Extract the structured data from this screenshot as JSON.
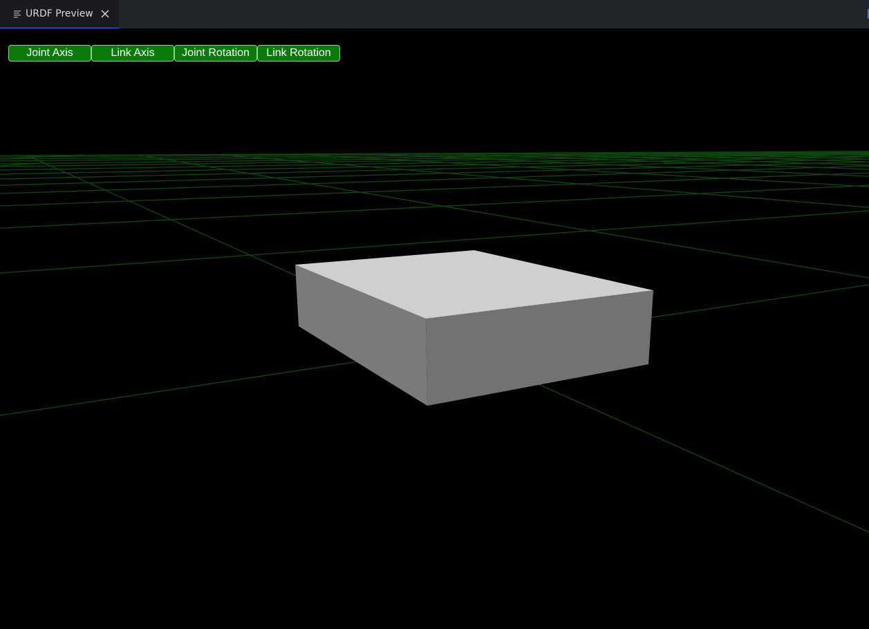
{
  "tab": {
    "title": "URDF Preview",
    "icon": "preview-icon",
    "close_icon": "close-icon"
  },
  "toolbar": {
    "buttons": [
      {
        "label": "Joint Axis"
      },
      {
        "label": "Link Axis"
      },
      {
        "label": "Joint Rotation"
      },
      {
        "label": "Link Rotation"
      }
    ],
    "button_color": "#0a7a0a",
    "button_border_color": "#8fd08f"
  },
  "scene": {
    "background_color": "#000000",
    "grid_color": "#0d4a0d",
    "box": {
      "top_color": "#cfcfcf",
      "front_color": "#727272",
      "side_color": "#7a7a7a"
    }
  }
}
